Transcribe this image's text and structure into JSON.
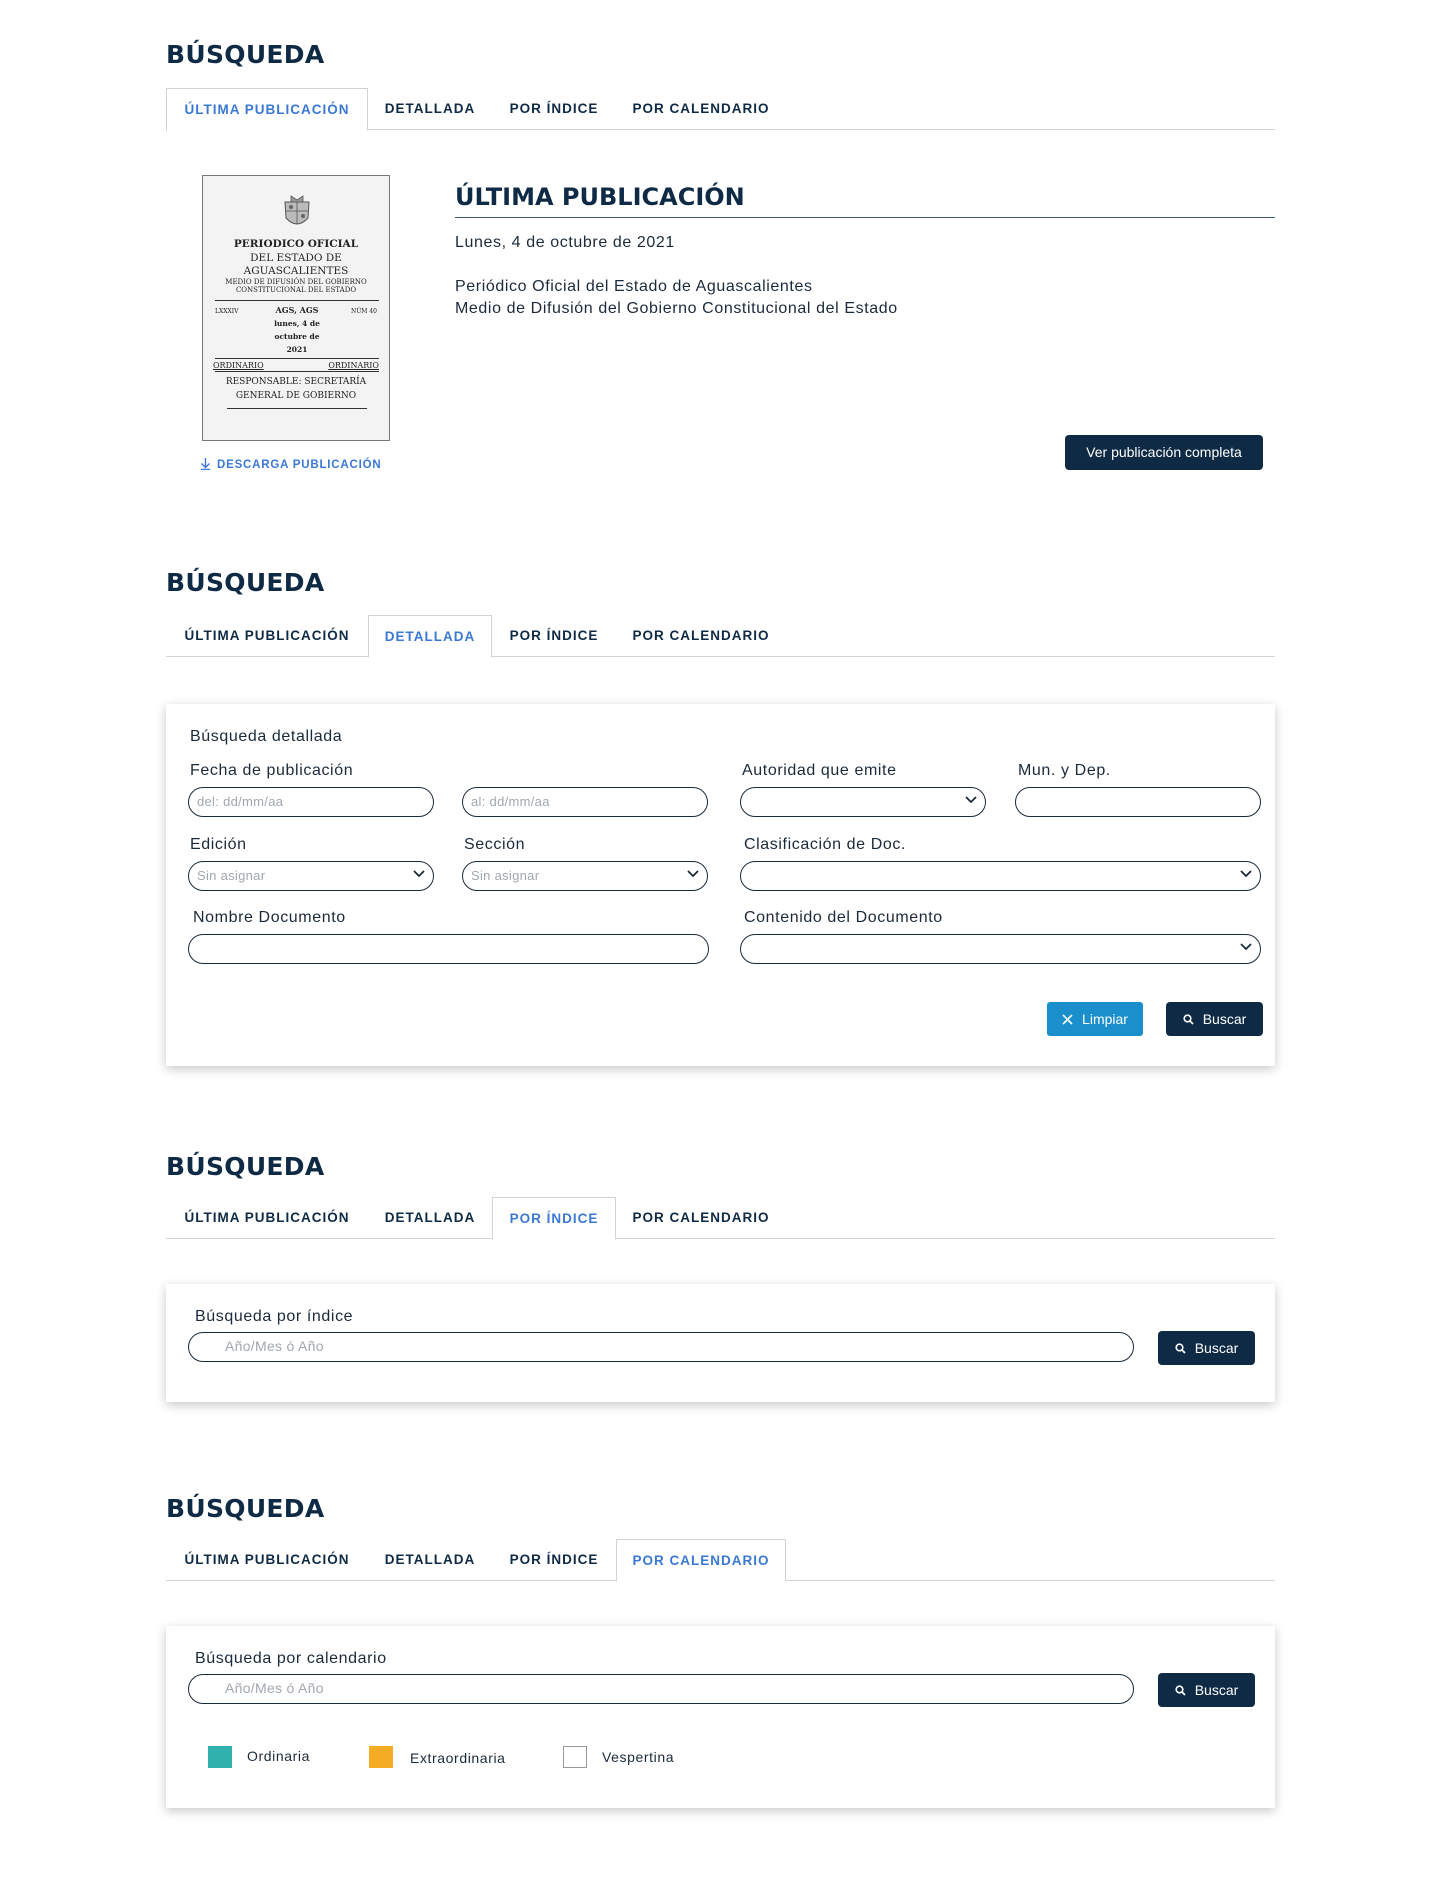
{
  "heading": "BÚSQUEDA",
  "tabs": [
    "ÚLTIMA PUBLICACIÓN",
    "DETALLADA",
    "POR ÍNDICE",
    "POR CALENDARIO"
  ],
  "latest": {
    "cover": {
      "line1": "PERIODICO OFICIAL",
      "line2": "DEL ESTADO DE",
      "line3": "AGUASCALIENTES",
      "line4": "MEDIO DE DIFUSIÓN DEL GOBIERNO CONSTITUCIONAL DEL ESTADO",
      "tomo": "LXXXIV",
      "place": "AGS, AGS",
      "num": "NÚM 40",
      "date": "lunes, 4 de octubre de 2021",
      "left_type": "ORDINARIO",
      "right_type": "ORDINARIO",
      "responsible": "RESPONSABLE: SECRETARÍA GENERAL DE GOBIERNO"
    },
    "download_label": "DESCARGA PUBLICACIÓN",
    "title": "ÚLTIMA PUBLICACIÓN",
    "date": "Lunes, 4 de octubre de 2021",
    "desc_line1": "Periódico Oficial del Estado de Aguascalientes",
    "desc_line2": "Medio de Difusión del Gobierno Constitucional del Estado",
    "view_button": "Ver publicación completa"
  },
  "detailed": {
    "title": "Búsqueda detallada",
    "fecha_label": "Fecha de publicación",
    "from_placeholder": "del: dd/mm/aa",
    "to_placeholder": "al: dd/mm/aa",
    "autoridad_label": "Autoridad que emite",
    "mun_label": "Mun. y Dep.",
    "edicion_label": "Edición",
    "edicion_value": "Sin asignar",
    "seccion_label": "Sección",
    "seccion_value": "Sin asignar",
    "clasificacion_label": "Clasificación de Doc.",
    "nombre_label": "Nombre Documento",
    "contenido_label": "Contenido del Documento",
    "clear_button": "Limpiar",
    "search_button": "Buscar"
  },
  "index": {
    "title": "Búsqueda por índice",
    "placeholder": "Año/Mes ó Año",
    "search_button": "Buscar"
  },
  "calendar": {
    "title": "Búsqueda por calendario",
    "placeholder": "Año/Mes ó Año",
    "search_button": "Buscar",
    "legend": [
      {
        "label": "Ordinaria",
        "color": "#2fb2ab"
      },
      {
        "label": "Extraordinaria",
        "color": "#f4ac24"
      },
      {
        "label": "Vespertina",
        "color": "#ffffff"
      }
    ]
  },
  "colors": {
    "navy": "#0f2a45",
    "accent_blue": "#3a78d4",
    "clear_button": "#1b8fcc"
  }
}
